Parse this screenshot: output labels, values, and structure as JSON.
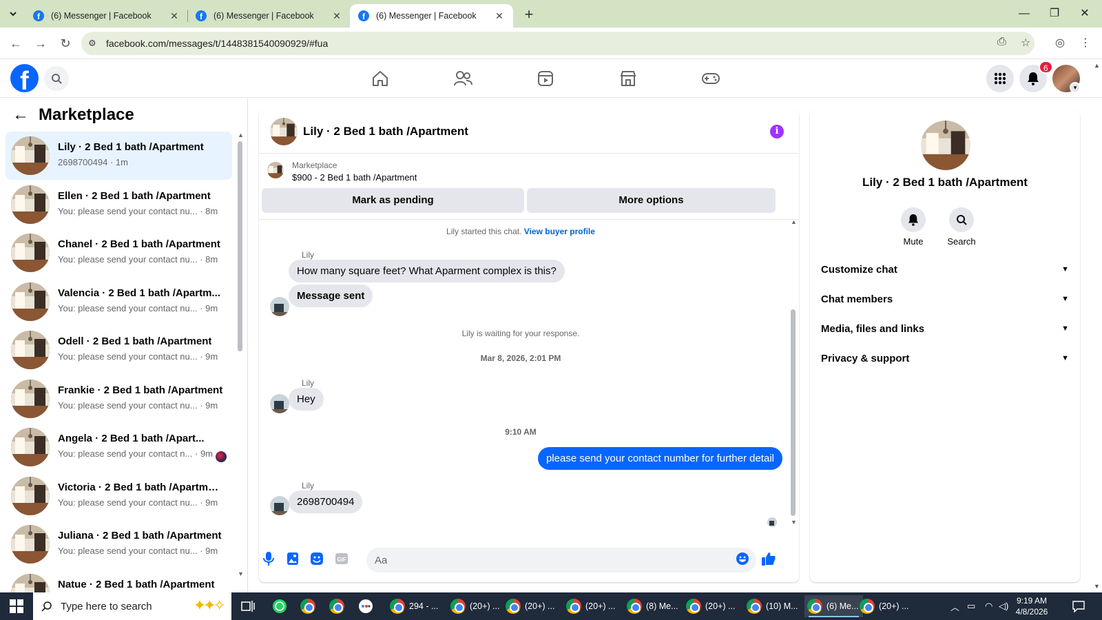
{
  "browser": {
    "tabs": [
      {
        "title": "(6) Messenger | Facebook",
        "active": false
      },
      {
        "title": "(6) Messenger | Facebook",
        "active": false
      },
      {
        "title": "(6) Messenger | Facebook",
        "active": true
      }
    ],
    "url": "facebook.com/messages/t/1448381540090929/#fua"
  },
  "fb": {
    "notification_count": "6"
  },
  "left": {
    "title": "Marketplace",
    "conversations": [
      {
        "name": "Lily · 2 Bed 1 bath /Apartment",
        "preview": "2698700494",
        "time": "· 1m",
        "active": true
      },
      {
        "name": "Ellen · 2 Bed 1 bath /Apartment",
        "preview": "You: please send your contact nu...",
        "time": "· 8m"
      },
      {
        "name": "Chanel · 2 Bed 1 bath /Apartment",
        "preview": "You: please send your contact nu...",
        "time": "· 8m"
      },
      {
        "name": "Valencia · 2 Bed 1 bath /Apartm...",
        "preview": "You: please send your contact nu...",
        "time": "· 9m"
      },
      {
        "name": "Odell · 2 Bed 1 bath /Apartment",
        "preview": "You: please send your contact nu...",
        "time": "· 9m"
      },
      {
        "name": "Frankie · 2 Bed 1 bath /Apartment",
        "preview": "You: please send your contact nu...",
        "time": "· 9m"
      },
      {
        "name": "Angela · 2 Bed 1 bath /Apart...",
        "preview": "You: please send your contact n...",
        "time": "· 9m"
      },
      {
        "name": "Victoria · 2 Bed 1 bath /Apartment",
        "preview": "You: please send your contact nu...",
        "time": "· 9m"
      },
      {
        "name": "Juliana · 2 Bed 1 bath /Apartment",
        "preview": "You: please send your contact nu...",
        "time": "· 9m"
      },
      {
        "name": "Natue · 2 Bed 1 bath /Apartment",
        "preview": "",
        "time": ""
      }
    ]
  },
  "chat": {
    "title": "Lily · 2 Bed 1 bath /Apartment",
    "marketplace_label": "Marketplace",
    "listing": "$900 - 2 Bed 1 bath /Apartment",
    "mark_pending": "Mark as pending",
    "more_options": "More options",
    "started_text": "Lily started this chat.",
    "view_profile": "View buyer profile",
    "sender": "Lily",
    "msg1": "How many square feet? What Aparment complex is this?",
    "msg2": "Message sent",
    "waiting": "Lily is waiting for your response.",
    "date1": "Mar 8, 2026, 2:01 PM",
    "msg3": "Hey",
    "time2": "9:10 AM",
    "msg_out": "please send your contact number for further detail",
    "msg4": "2698700494",
    "composer_placeholder": "Aa"
  },
  "right": {
    "name": "Lily · 2 Bed 1 bath /Apartment",
    "mute": "Mute",
    "search": "Search",
    "sections": [
      "Customize chat",
      "Chat members",
      "Media, files and links",
      "Privacy & support"
    ]
  },
  "taskbar": {
    "search_placeholder": "Type here to search",
    "items": [
      "294 - ...",
      "(20+) ...",
      "(20+) ...",
      "(20+) ...",
      "(8) Me...",
      "(20+) ...",
      "(10) M...",
      "(6) Me...",
      "(20+) ..."
    ],
    "time": "9:19 AM",
    "date": "4/8/2026"
  },
  "colors": {
    "accent": "#0866ff",
    "info": "#a033ff",
    "badge": "#e41e3f",
    "tabstrip": "#d3e3c4"
  }
}
